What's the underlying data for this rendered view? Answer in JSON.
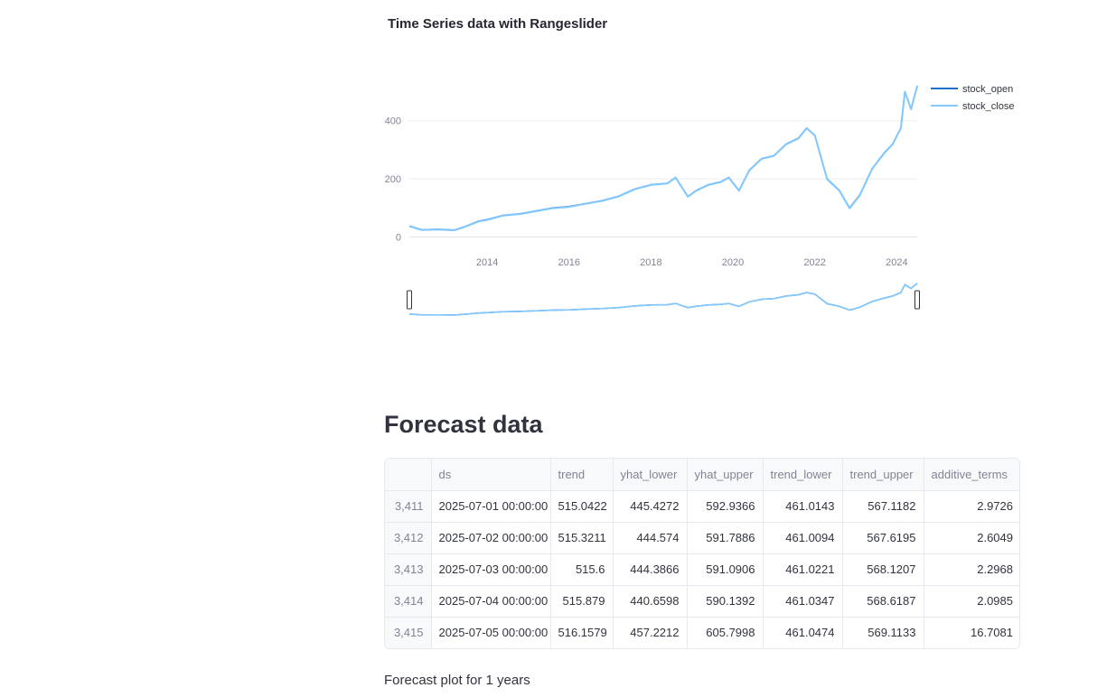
{
  "chart_data": {
    "type": "line",
    "title": "Time Series data with Rangeslider",
    "legend_position": "top-right",
    "grid": true,
    "xlim": [
      2012.1,
      2024.5
    ],
    "ylim": [
      -20,
      545
    ],
    "x_ticks": [
      {
        "value": 2014,
        "label": "2014"
      },
      {
        "value": 2016,
        "label": "2016"
      },
      {
        "value": 2018,
        "label": "2018"
      },
      {
        "value": 2020,
        "label": "2020"
      },
      {
        "value": 2022,
        "label": "2022"
      },
      {
        "value": 2024,
        "label": "2024"
      }
    ],
    "y_ticks": [
      {
        "value": 0,
        "label": "0"
      },
      {
        "value": 200,
        "label": "200"
      },
      {
        "value": 400,
        "label": "400"
      }
    ],
    "series": [
      {
        "name": "stock_open",
        "color": "#1f6fd1",
        "x": [
          2012.1,
          2012.4,
          2012.8,
          2013.2,
          2013.5,
          2013.8,
          2014.0,
          2014.4,
          2014.8,
          2015.2,
          2015.6,
          2016.0,
          2016.4,
          2016.8,
          2017.2,
          2017.6,
          2018.0,
          2018.4,
          2018.6,
          2018.9,
          2019.1,
          2019.4,
          2019.7,
          2019.9,
          2020.15,
          2020.4,
          2020.7,
          2021.0,
          2021.3,
          2021.6,
          2021.8,
          2022.0,
          2022.3,
          2022.6,
          2022.85,
          2023.1,
          2023.4,
          2023.7,
          2023.9,
          2024.1,
          2024.2,
          2024.35,
          2024.5
        ],
        "y": [
          38,
          25,
          27,
          24,
          38,
          55,
          60,
          75,
          80,
          90,
          100,
          105,
          115,
          125,
          140,
          165,
          180,
          185,
          205,
          140,
          160,
          180,
          190,
          205,
          160,
          230,
          270,
          280,
          320,
          340,
          375,
          350,
          200,
          160,
          100,
          145,
          235,
          290,
          320,
          375,
          500,
          440,
          520
        ]
      },
      {
        "name": "stock_close",
        "color": "#83c9ff",
        "x": [
          2012.1,
          2012.4,
          2012.8,
          2013.2,
          2013.5,
          2013.8,
          2014.0,
          2014.4,
          2014.8,
          2015.2,
          2015.6,
          2016.0,
          2016.4,
          2016.8,
          2017.2,
          2017.6,
          2018.0,
          2018.4,
          2018.6,
          2018.9,
          2019.1,
          2019.4,
          2019.7,
          2019.9,
          2020.15,
          2020.4,
          2020.7,
          2021.0,
          2021.3,
          2021.6,
          2021.8,
          2022.0,
          2022.3,
          2022.6,
          2022.85,
          2023.1,
          2023.4,
          2023.7,
          2023.9,
          2024.1,
          2024.2,
          2024.35,
          2024.5
        ],
        "y": [
          37,
          24,
          26,
          23,
          37,
          54,
          59,
          74,
          79,
          89,
          99,
          104,
          114,
          124,
          139,
          164,
          179,
          184,
          204,
          139,
          159,
          179,
          189,
          204,
          159,
          229,
          269,
          279,
          319,
          339,
          374,
          349,
          199,
          159,
          99,
          144,
          234,
          289,
          319,
          374,
          499,
          439,
          519
        ]
      }
    ]
  },
  "forecast": {
    "heading": "Forecast data",
    "columns": [
      "",
      "ds",
      "trend",
      "yhat_lower",
      "yhat_upper",
      "trend_lower",
      "trend_upper",
      "additive_terms"
    ],
    "rows": [
      [
        "3,411",
        "2025-07-01 00:00:00",
        "515.0422",
        "445.4272",
        "592.9366",
        "461.0143",
        "567.1182",
        "2.9726"
      ],
      [
        "3,412",
        "2025-07-02 00:00:00",
        "515.3211",
        "444.574",
        "591.7886",
        "461.0094",
        "567.6195",
        "2.6049"
      ],
      [
        "3,413",
        "2025-07-03 00:00:00",
        "515.6",
        "444.3866",
        "591.0906",
        "461.0221",
        "568.1207",
        "2.2968"
      ],
      [
        "3,414",
        "2025-07-04 00:00:00",
        "515.879",
        "440.6598",
        "590.1392",
        "461.0347",
        "568.6187",
        "2.0985"
      ],
      [
        "3,415",
        "2025-07-05 00:00:00",
        "516.1579",
        "457.2212",
        "605.7998",
        "461.0474",
        "569.1133",
        "16.7081"
      ]
    ]
  },
  "footer": {
    "text": "Forecast plot for 1 years"
  }
}
